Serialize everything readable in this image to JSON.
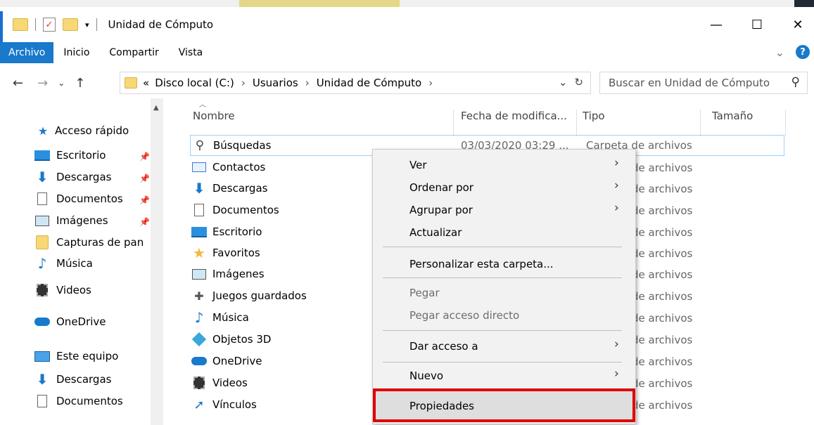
{
  "window": {
    "title": "Unidad de Cómputo"
  },
  "window_controls": {
    "minimize": "—",
    "maximize": "☐",
    "close": "✕"
  },
  "ribbon": {
    "tabs": [
      "Archivo",
      "Inicio",
      "Compartir",
      "Vista"
    ],
    "expand": "⌄",
    "help": "?"
  },
  "address": {
    "prefix": "«",
    "crumbs": [
      "Disco local (C:)",
      "Usuarios",
      "Unidad de Cómputo"
    ],
    "sep": "›",
    "dropdown": "⌄",
    "refresh": "↻"
  },
  "search": {
    "placeholder": "Buscar en Unidad de Cómputo"
  },
  "navigation": {
    "quick_access": "Acceso rápido",
    "items": [
      "Escritorio",
      "Descargas",
      "Documentos",
      "Imágenes",
      "Capturas de pan",
      "Música",
      "Videos"
    ],
    "onedrive": "OneDrive",
    "this_pc": "Este equipo",
    "pc_items": [
      "Descargas",
      "Documentos"
    ]
  },
  "columns": {
    "name": "Nombre",
    "date": "Fecha de modifica...",
    "type": "Tipo",
    "size": "Tamaño"
  },
  "files": [
    {
      "name": "Búsquedas",
      "date": "03/03/2020 03:29 ...",
      "type": "Carpeta de archivos",
      "icon": "search-icon"
    },
    {
      "name": "Contactos",
      "type_visible": "de archivos",
      "icon": "contacts-icon"
    },
    {
      "name": "Descargas",
      "type_visible": "de archivos",
      "icon": "download-icon"
    },
    {
      "name": "Documentos",
      "type_visible": "de archivos",
      "icon": "document-icon"
    },
    {
      "name": "Escritorio",
      "type_visible": "de archivos",
      "icon": "desktop-icon"
    },
    {
      "name": "Favoritos",
      "type_visible": "de archivos",
      "icon": "star-icon"
    },
    {
      "name": "Imágenes",
      "type_visible": "de archivos",
      "icon": "image-icon"
    },
    {
      "name": "Juegos guardados",
      "type_visible": "de archivos",
      "icon": "game-icon"
    },
    {
      "name": "Música",
      "type_visible": "de archivos",
      "icon": "music-icon"
    },
    {
      "name": "Objetos 3D",
      "type_visible": "de archivos",
      "icon": "cube-icon"
    },
    {
      "name": "OneDrive",
      "type_visible": "de archivos",
      "icon": "cloud-icon"
    },
    {
      "name": "Videos",
      "type_visible": "de archivos",
      "icon": "video-icon"
    },
    {
      "name": "Vínculos",
      "type_visible": "de archivos",
      "icon": "link-icon"
    }
  ],
  "context_menu": {
    "ver": "Ver",
    "ordenar": "Ordenar por",
    "agrupar": "Agrupar por",
    "actualizar": "Actualizar",
    "personalizar": "Personalizar esta carpeta...",
    "pegar": "Pegar",
    "pegar_acceso": "Pegar acceso directo",
    "dar_acceso": "Dar acceso a",
    "nuevo": "Nuevo",
    "propiedades": "Propiedades",
    "submenu_arrow": "›"
  },
  "colors": {
    "accent": "#1979ca",
    "highlight_border": "#e00000",
    "selection_border": "#99d1ff",
    "folder": "#f8d775"
  }
}
